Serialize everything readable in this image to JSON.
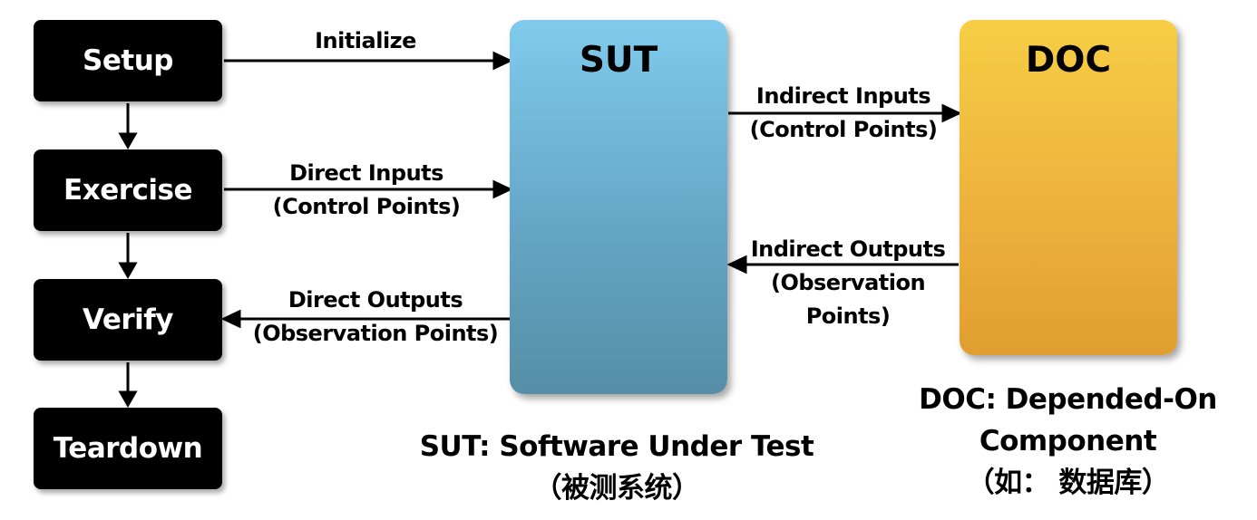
{
  "phases": [
    "Setup",
    "Exercise",
    "Verify",
    "Teardown"
  ],
  "sut": {
    "title": "SUT",
    "caption_line1": "SUT: Software Under Test",
    "caption_line2": "（被测系统）"
  },
  "doc": {
    "title": "DOC",
    "caption_line1": "DOC: Depended-On",
    "caption_line2": "Component",
    "caption_line3": "（如： 数据库）"
  },
  "arrows": {
    "initialize": "Initialize",
    "direct_inputs_line1": "Direct Inputs",
    "direct_inputs_line2": "(Control Points)",
    "direct_outputs_line1": "Direct Outputs",
    "direct_outputs_line2": "(Observation Points)",
    "indirect_inputs_line1": "Indirect Inputs",
    "indirect_inputs_line2": "(Control Points)",
    "indirect_outputs_line1": "Indirect Outputs",
    "indirect_outputs_line2": "(Observation",
    "indirect_outputs_line3": "Points)"
  }
}
